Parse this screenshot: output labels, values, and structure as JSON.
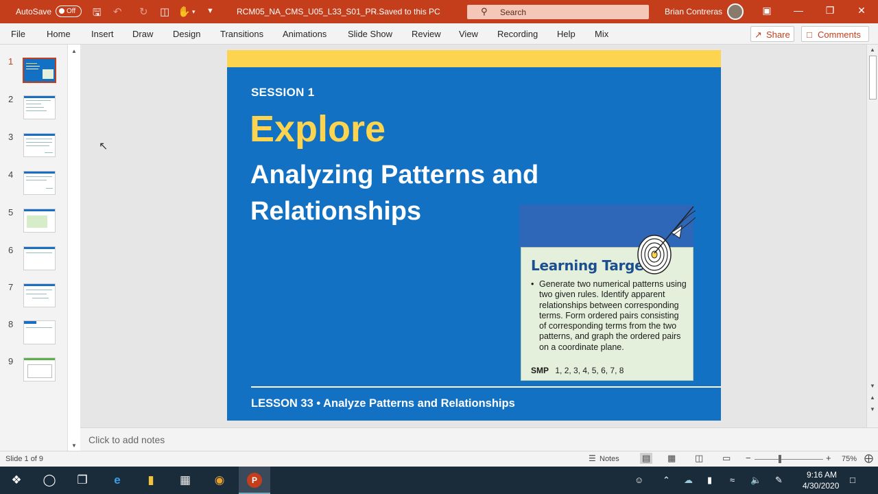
{
  "titlebar": {
    "autosave_label": "AutoSave",
    "autosave_state": "Off",
    "document_title": "RCM05_NA_CMS_U05_L33_S01_PR...",
    "save_status": "-  Saved to this PC",
    "search_placeholder": "Search",
    "user_name": "Brian Contreras"
  },
  "ribbon": {
    "tabs": [
      "File",
      "Home",
      "Insert",
      "Draw",
      "Design",
      "Transitions",
      "Animations",
      "Slide Show",
      "Review",
      "View",
      "Recording",
      "Help",
      "Mix"
    ],
    "share_label": "Share",
    "comments_label": "Comments"
  },
  "thumbnails": {
    "numbers": [
      "1",
      "2",
      "3",
      "4",
      "5",
      "6",
      "7",
      "8",
      "9"
    ],
    "active_index": 0
  },
  "slide": {
    "session": "SESSION 1",
    "title": "Explore",
    "subtitle": "Analyzing Patterns and Relationships",
    "learning_target": {
      "heading": "Learning Target",
      "bullet": "Generate two numerical patterns using two given rules. Identify apparent relationships between corresponding terms. Form ordered pairs consisting of corresponding terms from the two patterns, and graph the ordered pairs on a coordinate plane.",
      "smp_label": "SMP",
      "smp_values": "1, 2, 3, 4, 5, 6, 7, 8"
    },
    "footer": "LESSON 33 • Analyze Patterns and Relationships",
    "colors": {
      "background": "#1371c4",
      "accent": "#fcd44f",
      "card": "#e5f0dc"
    }
  },
  "notes": {
    "placeholder": "Click to add notes"
  },
  "statusbar": {
    "slide_indicator": "Slide 1 of 9",
    "notes_label": "Notes",
    "zoom": "75%"
  },
  "taskbar": {
    "time": "9:16 AM",
    "date": "4/30/2020"
  }
}
